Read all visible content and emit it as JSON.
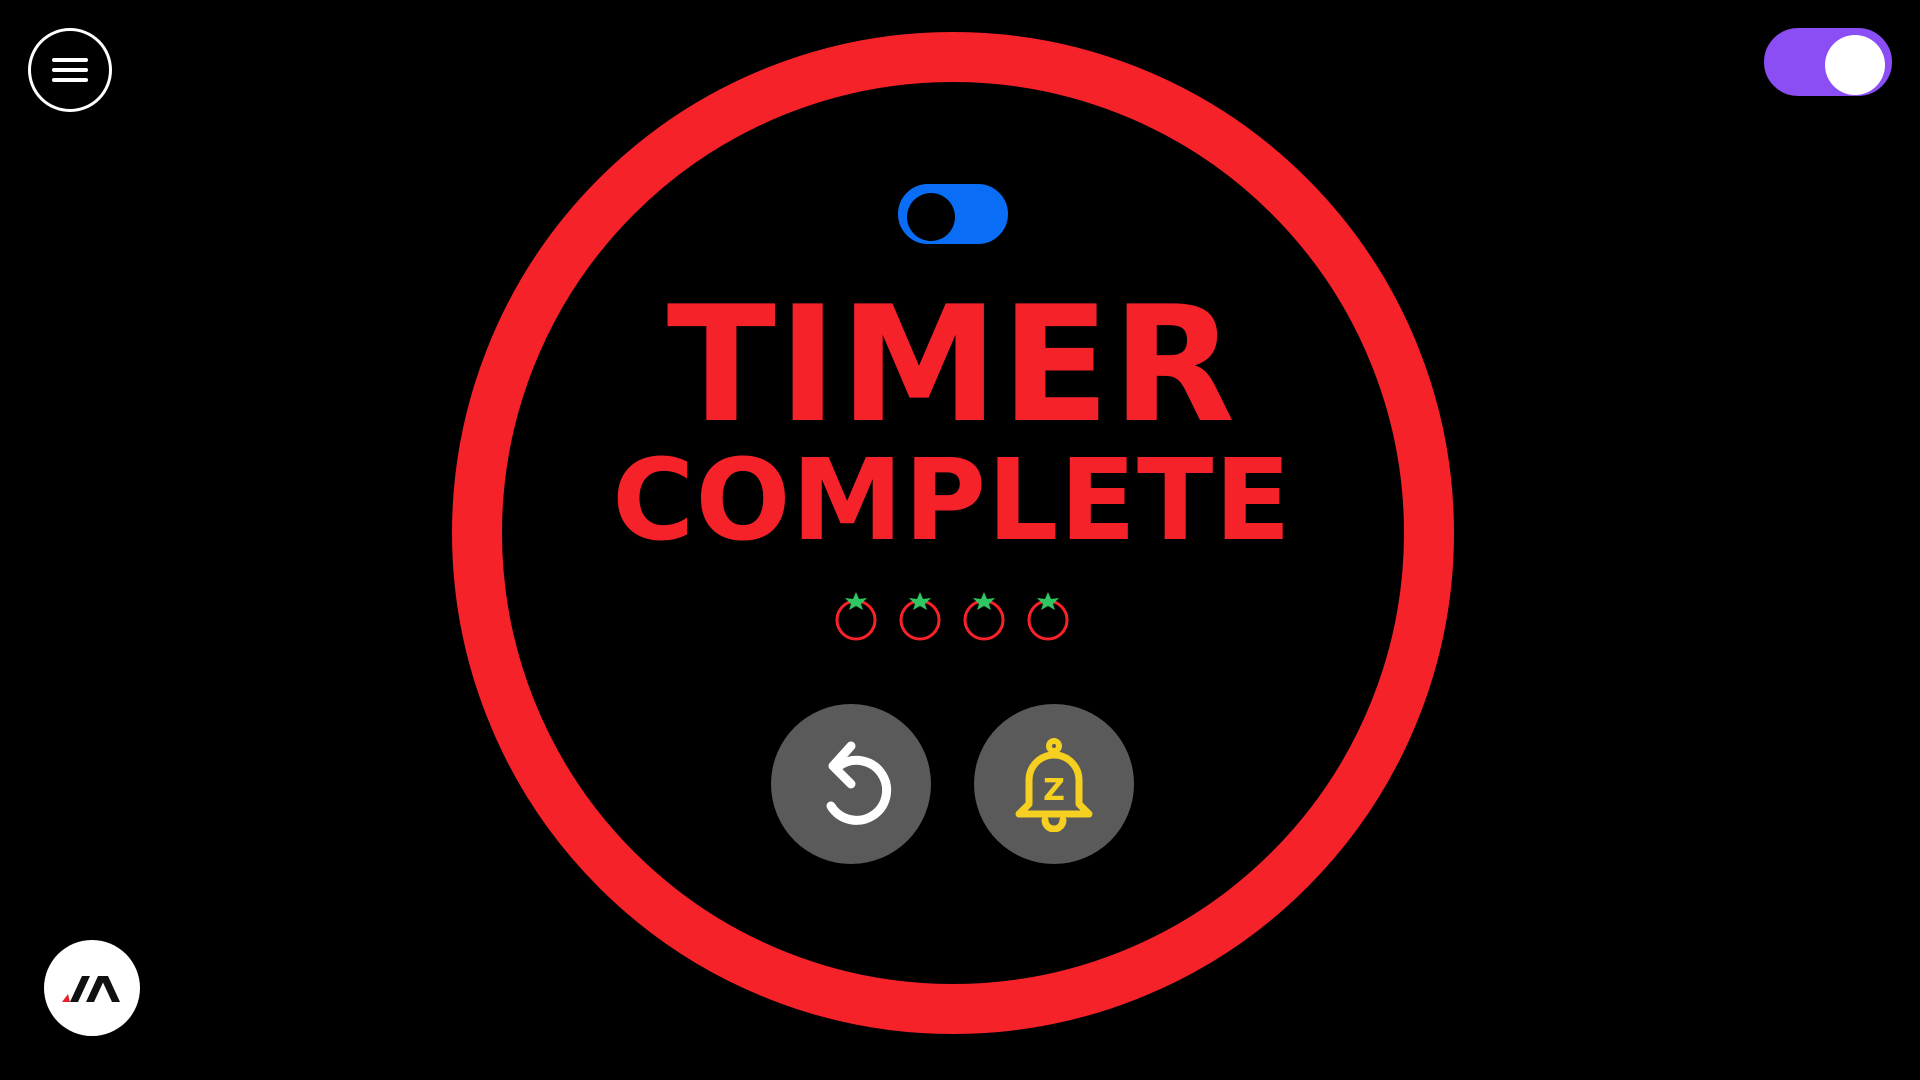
{
  "app": {
    "title_line_1": "TIMER",
    "title_line_2": "COMPLETE"
  },
  "state": {
    "theme_toggle_on": true,
    "mode_switch_on": true,
    "completed_pomodoros": 4
  },
  "icons": {
    "menu": "hamburger-menu-icon",
    "restart": "restart-icon",
    "snooze": "snooze-bell-icon",
    "tomato": "tomato-icon",
    "logo": "brand-logo-icon"
  },
  "colors": {
    "background": "#000000",
    "accent_red": "#f5222a",
    "theme_toggle": "#8b4ef5",
    "mode_switch": "#0a6df5",
    "button_bg": "#5a5a5a",
    "restart_icon": "#ffffff",
    "snooze_icon": "#f5d020",
    "tomato_leaf": "#2ec760",
    "logo_red": "#e8202a"
  }
}
